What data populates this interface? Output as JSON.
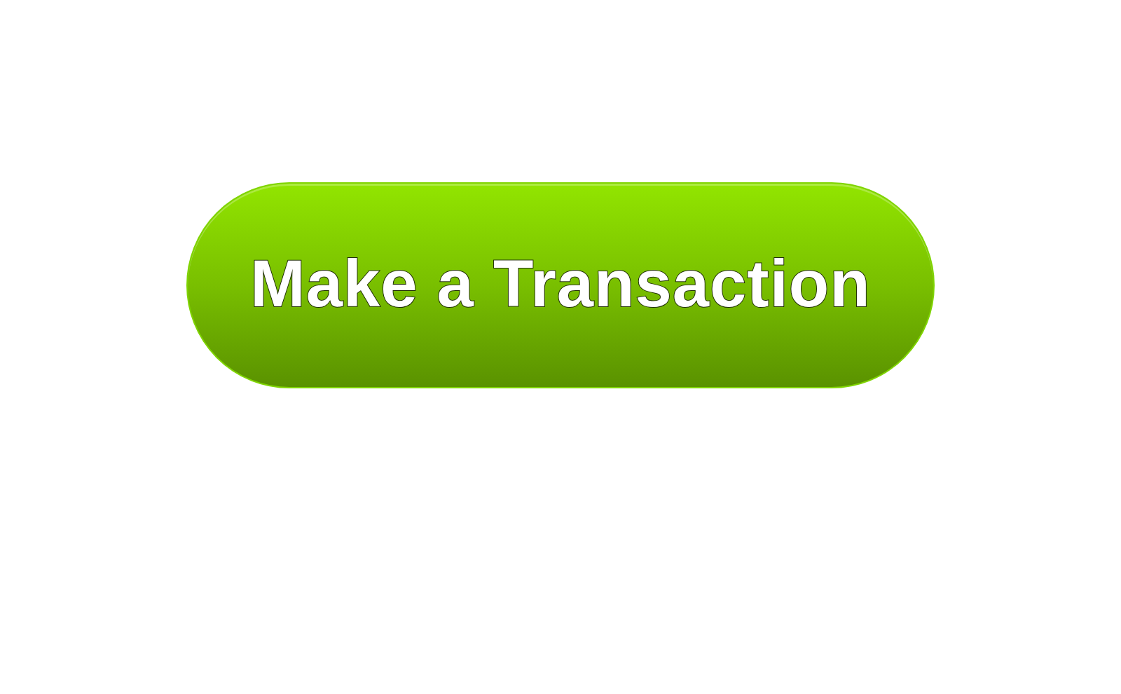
{
  "button": {
    "label": "Make a Transaction"
  }
}
